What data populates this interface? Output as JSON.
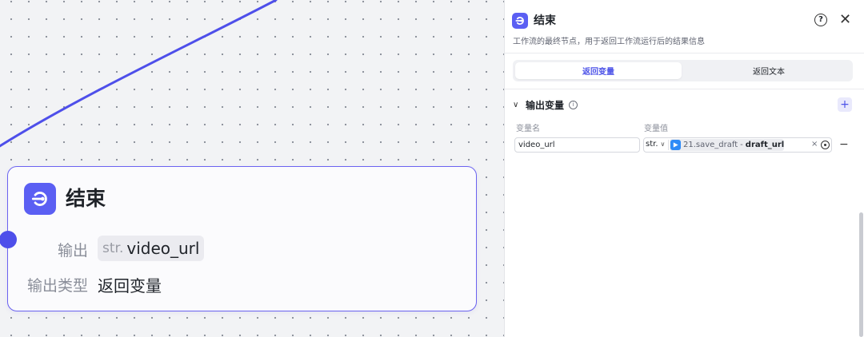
{
  "canvas": {
    "end_node": {
      "title": "结束",
      "output_label": "输出",
      "output_var_type": "str.",
      "output_var_name": "video_url",
      "output_type_label": "输出类型",
      "output_type_value": "返回变量"
    }
  },
  "panel": {
    "title": "结束",
    "description": "工作流的最终节点，用于返回工作流运行后的结果信息",
    "help_icon": "help-circle-icon",
    "tabs": [
      {
        "label": "返回变量",
        "active": true
      },
      {
        "label": "返回文本",
        "active": false
      }
    ],
    "section": {
      "title": "输出变量",
      "add_label": "+"
    },
    "columns": {
      "name": "变量名",
      "value": "变量值"
    },
    "row": {
      "name_value": "video_url",
      "type": "str.",
      "ref_node": "21.save_draft",
      "ref_separator": "-",
      "ref_field": "draft_url",
      "clear_label": "×",
      "remove_label": "−"
    }
  },
  "colors": {
    "accent": "#5b5ff3",
    "node_border": "#6b63f0",
    "edge": "#4e4fea",
    "ref_icon": "#2f8bf7"
  }
}
